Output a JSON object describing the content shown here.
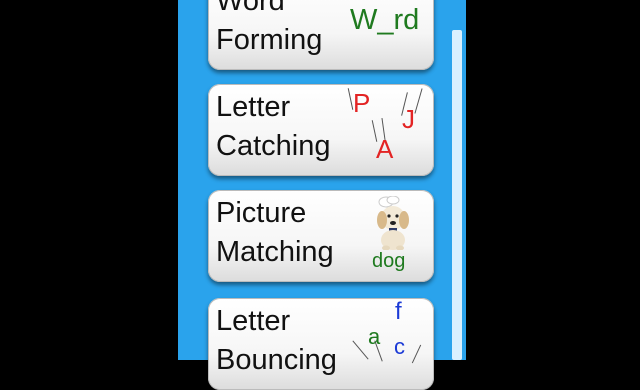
{
  "games": [
    {
      "label_line1": "Word",
      "label_line2": "Forming",
      "preview_text": "W_rd"
    },
    {
      "label_line1": "Letter",
      "label_line2": "Catching",
      "preview_letters": [
        "P",
        "J",
        "A"
      ]
    },
    {
      "label_line1": "Picture",
      "label_line2": "Matching",
      "preview_caption": "dog"
    },
    {
      "label_line1": "Letter",
      "label_line2": "Bouncing",
      "preview_letters": [
        "a",
        "f",
        "c"
      ]
    }
  ],
  "colors": {
    "background": "#2aa3ec",
    "green_text": "#1f7a1f",
    "red_letters": "#e32424",
    "blue_letters": "#1c3bd6"
  }
}
